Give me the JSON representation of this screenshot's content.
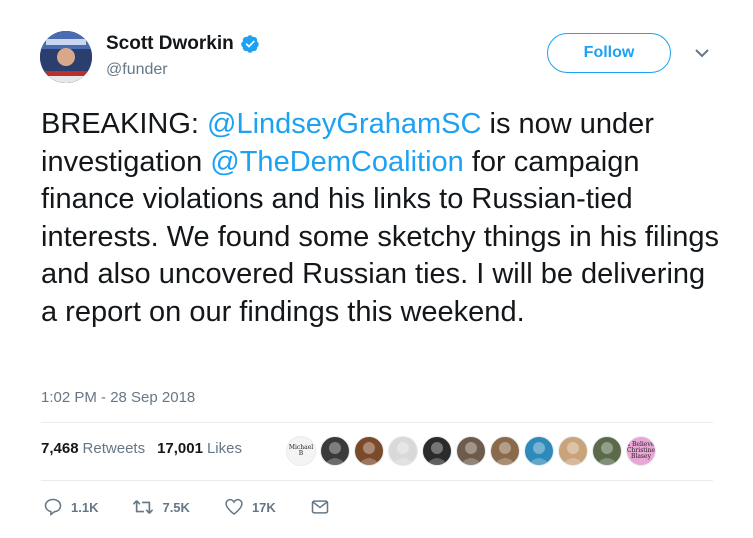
{
  "author": {
    "name": "Scott Dworkin",
    "handle": "@funder",
    "verified": true
  },
  "follow_label": "Follow",
  "tweet": {
    "segments": [
      {
        "text": "BREAKING: ",
        "mention": false
      },
      {
        "text": "@LindseyGrahamSC",
        "mention": true
      },
      {
        "text": " is now under investigation ",
        "mention": false
      },
      {
        "text": "@TheDemCoalition",
        "mention": true
      },
      {
        "text": " for campaign finance violations and his links to Russian-tied interests. We found some sketchy things in his filings and also uncovered Russian ties. I will be delivering a report on our findings this weekend.",
        "mention": false
      }
    ],
    "timestamp": "1:02 PM - 28 Sep 2018"
  },
  "stats": {
    "retweets_count": "7,468",
    "retweets_label": "Retweets",
    "likes_count": "17,001",
    "likes_label": "Likes"
  },
  "liker_avatars": [
    {
      "label": "Michael B",
      "bg": "#f4f4f4"
    },
    {
      "bg": "#3a3a3a"
    },
    {
      "bg": "#7a4a2a"
    },
    {
      "bg": "#d9d9d9"
    },
    {
      "bg": "#2b2b2b"
    },
    {
      "bg": "#6f5b4b"
    },
    {
      "bg": "#8a6a4a"
    },
    {
      "bg": "#2e8ab8"
    },
    {
      "bg": "#c9a37a"
    },
    {
      "bg": "#5a6a4a"
    },
    {
      "label": "I Believe Christine Blasey",
      "bg": "#e9a6d6"
    }
  ],
  "actions": {
    "reply_count": "1.1K",
    "retweet_count": "7.5K",
    "like_count": "17K"
  },
  "colors": {
    "accent": "#1da1f2",
    "text": "#14171a",
    "muted": "#657786"
  }
}
